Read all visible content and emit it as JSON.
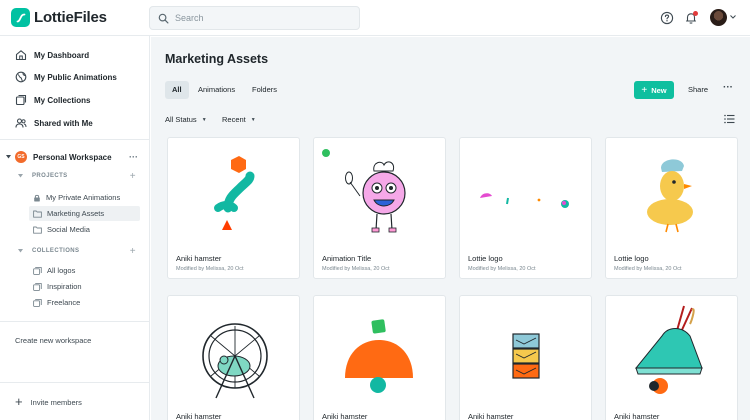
{
  "app": {
    "brand": "LottieFiles"
  },
  "search": {
    "placeholder": "Search"
  },
  "sidebar": {
    "nav": [
      {
        "label": "My Dashboard",
        "icon": "home-icon"
      },
      {
        "label": "My Public Animations",
        "icon": "globe-icon"
      },
      {
        "label": "My Collections",
        "icon": "collections-icon"
      },
      {
        "label": "Shared with Me",
        "icon": "users-icon"
      }
    ],
    "workspace": {
      "badge": "GS",
      "name": "Personal Workspace",
      "more": "···"
    },
    "projects_header": "PROJECTS",
    "projects": [
      {
        "label": "My Private Animations",
        "icon": "lock-icon"
      },
      {
        "label": "Marketing Assets",
        "icon": "folder-icon"
      },
      {
        "label": "Social Media",
        "icon": "folder-icon"
      }
    ],
    "collections_header": "COLLECTIONS",
    "collections": [
      {
        "label": "All logos"
      },
      {
        "label": "Inspiration"
      },
      {
        "label": "Freelance"
      }
    ],
    "create_workspace": "Create new workspace",
    "invite": "Invite members"
  },
  "main": {
    "title": "Marketing Assets",
    "tabs": [
      "All",
      "Animations",
      "Folders"
    ],
    "active_tab": "All",
    "new_button": "New",
    "share": "Share",
    "filters": {
      "status": "All Status",
      "sort": "Recent"
    },
    "cards": [
      {
        "name": "Aniki hamster",
        "meta": "Modified by Melissa, 20 Oct"
      },
      {
        "name": "Animation Title",
        "meta": "Modified by Melissa, 20 Oct"
      },
      {
        "name": "Lottie logo",
        "meta": "Modified by Melissa, 20 Oct"
      },
      {
        "name": "Lottie logo",
        "meta": "Modified by Melissa, 20 Oct"
      },
      {
        "name": "Aniki hamster",
        "meta": ""
      },
      {
        "name": "Aniki hamster",
        "meta": ""
      },
      {
        "name": "Aniki hamster",
        "meta": ""
      },
      {
        "name": "Aniki hamster",
        "meta": ""
      }
    ]
  },
  "colors": {
    "accent": "#0fbf9f",
    "brand": "#00c1a2",
    "notification": "#e23b3b",
    "workspace_badge": "#f26b2b"
  }
}
